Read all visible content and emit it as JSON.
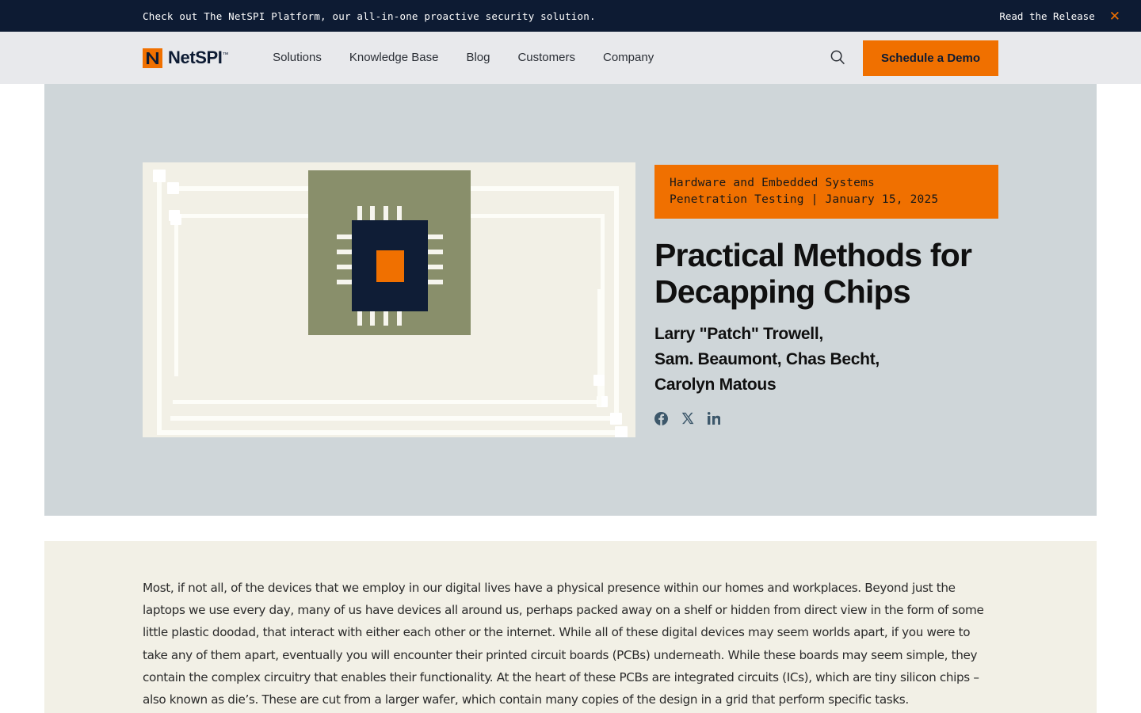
{
  "announcement": {
    "message": "Check out The NetSPI Platform, our all-in-one proactive security solution.",
    "link_label": "Read the Release",
    "close_icon": "close-icon",
    "close_glyph": "✕",
    "bg_color": "#0d1b33",
    "accent_color": "#f07000"
  },
  "nav": {
    "brand_name": "NetSPI",
    "brand_tm": "™",
    "brand_mark_letter": "N",
    "items": [
      {
        "label": "Solutions"
      },
      {
        "label": "Knowledge Base"
      },
      {
        "label": "Blog"
      },
      {
        "label": "Customers"
      },
      {
        "label": "Company"
      }
    ],
    "search_icon": "search-icon",
    "cta_label": "Schedule a Demo",
    "bg_color": "#e8e9ec"
  },
  "hero": {
    "bg_color": "#cfd6d9",
    "category_badge": "Hardware and Embedded Systems\nPenetration Testing | January 15, 2025",
    "category_line_1": "Hardware and Embedded Systems",
    "category_line_2": "Penetration Testing | January 15, 2025",
    "title": "Practical Methods for Decapping Chips",
    "authors": "Larry \"Patch\" Trowell, Sam. Beaumont, Chas Becht, Carolyn Matous",
    "author_line_1": "Larry \"Patch\" Trowell,",
    "author_line_2": "Sam. Beaumont, Chas Becht,",
    "author_line_3": "Carolyn Matous",
    "social": [
      {
        "name": "facebook-icon",
        "label": "Facebook"
      },
      {
        "name": "x-twitter-icon",
        "label": "X"
      },
      {
        "name": "linkedin-icon",
        "label": "LinkedIn"
      }
    ],
    "illustration": {
      "name": "decapped-chip-illustration",
      "bg_color": "#f2f0e6",
      "plate_color": "#898f6b",
      "chip_color": "#0f1d36",
      "core_color": "#f07000",
      "trace_color": "#fdfdf8"
    }
  },
  "article": {
    "bg_color": "#f2f0e6",
    "paragraph": "Most, if not all, of the devices that we employ in our digital lives have a physical presence within our homes and workplaces. Beyond just the laptops we use every day, many of us have devices all around us, perhaps packed away on a shelf or hidden from direct view in the form of some little plastic doodad, that interact with either each other or the internet. While all of these digital devices may seem worlds apart, if you were to take any of them apart, eventually you will encounter their printed circuit boards (PCBs) underneath. While these boards may seem simple, they contain the complex circuitry that enables their functionality. At the heart of these PCBs are integrated circuits (ICs), which are tiny silicon chips – also known as die’s. These are cut from a larger wafer, which contain many copies of the design in a grid that perform specific tasks."
  }
}
